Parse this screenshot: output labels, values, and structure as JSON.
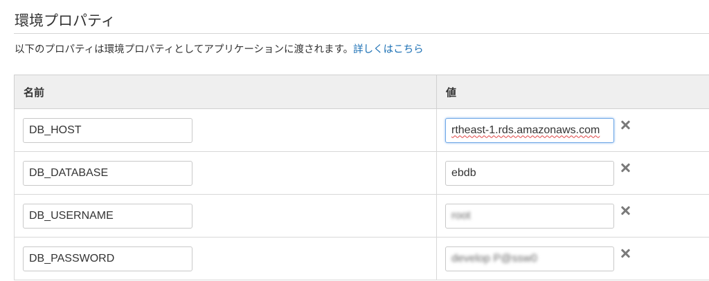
{
  "section": {
    "title": "環境プロパティ",
    "description": "以下のプロパティは環境プロパティとしてアプリケーションに渡されます。",
    "learn_more_link": "詳しくはこちら"
  },
  "table": {
    "headers": {
      "name": "名前",
      "value": "値"
    },
    "rows": [
      {
        "name": "DB_HOST",
        "value": "rtheast-1.rds.amazonaws.com",
        "focused": true,
        "obscured": false
      },
      {
        "name": "DB_DATABASE",
        "value": "ebdb",
        "focused": false,
        "obscured": false
      },
      {
        "name": "DB_USERNAME",
        "value": "root",
        "focused": false,
        "obscured": true
      },
      {
        "name": "DB_PASSWORD",
        "value": "develop P@ssw0",
        "focused": false,
        "obscured": true
      }
    ],
    "remove_icon": "close-icon"
  },
  "colors": {
    "link": "#1a6fb4",
    "header_bg": "#efefef",
    "focus_border": "#6fa7e6"
  }
}
